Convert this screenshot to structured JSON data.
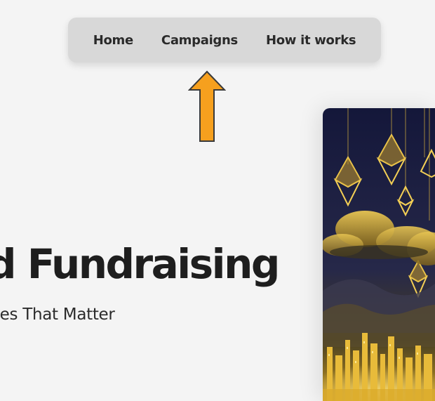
{
  "nav": {
    "items": [
      {
        "label": "Home"
      },
      {
        "label": "Campaigns"
      },
      {
        "label": "How it works"
      }
    ]
  },
  "hero": {
    "title": "d Fundraising",
    "subtitle": "ses That Matter"
  },
  "colors": {
    "arrow_fill": "#f6a01e",
    "nav_background": "#d8d8d8",
    "page_background": "#f4f4f4",
    "text": "#1e1e1e",
    "image_gold": "#f0c64a",
    "image_night": "#1b1c3a"
  },
  "icons": {
    "annotation_arrow": "arrow-up-icon",
    "hero_image": "ethereum-city-illustration"
  }
}
